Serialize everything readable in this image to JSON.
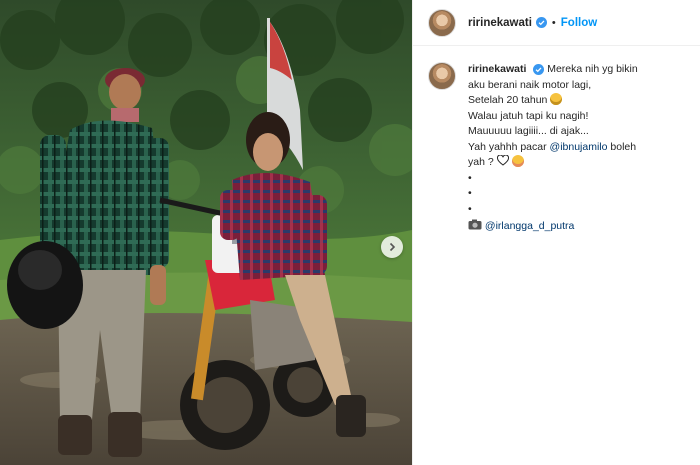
{
  "post": {
    "username": "ririnekawati",
    "separator": "•",
    "follow_label": "Follow",
    "caption_lines": [
      "Mereka nih yg bikin",
      "aku berani naik motor lagi,",
      "Setelah 20 tahun",
      "Walau jatuh tapi ku nagih!",
      "Mauuuuu lagiiii... di ajak...",
      "Yah yahhh pacar ",
      "yah ?",
      "•",
      "•",
      "•"
    ],
    "mention_pacar": "@ibnujamilo",
    "post_suffix": " boleh",
    "photo_credit_mention": "@irlangga_d_putra"
  },
  "icons": {
    "verified": "verified-badge-icon",
    "next": "chevron-right-icon",
    "camera": "camera-icon",
    "heart": "heart-icon",
    "grin": "grinning-face-icon",
    "blush": "smiling-face-icon"
  },
  "colors": {
    "accent": "#0095f6",
    "mention": "#00376b",
    "text": "#262626",
    "border": "#efefef"
  }
}
